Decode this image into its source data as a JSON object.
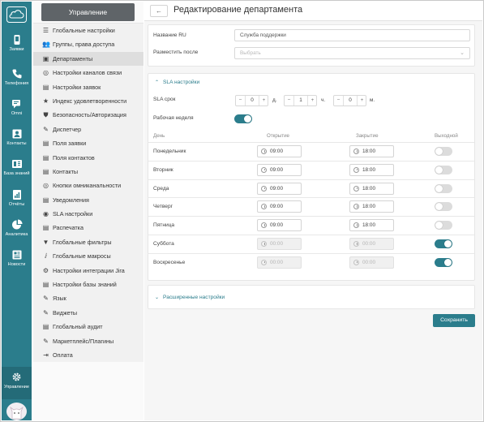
{
  "rail": {
    "items": [
      {
        "label": "Заявки",
        "icon": "phone-device-icon"
      },
      {
        "label": "Телефония",
        "icon": "phone-icon"
      },
      {
        "label": "Omni",
        "icon": "chat-icon"
      },
      {
        "label": "Контакты",
        "icon": "contacts-icon"
      },
      {
        "label": "База знаний",
        "icon": "knowledge-base-icon"
      },
      {
        "label": "Отчёты",
        "icon": "reports-icon"
      },
      {
        "label": "Аналитика",
        "icon": "pie-chart-icon"
      },
      {
        "label": "Новости",
        "icon": "news-icon"
      }
    ],
    "bottom_label": "Управление"
  },
  "menu": {
    "title": "Управление",
    "items": [
      {
        "label": "Глобальные настройки",
        "icon": "sliders-icon"
      },
      {
        "label": "Группы, права доступа",
        "icon": "users-icon"
      },
      {
        "label": "Департаменты",
        "icon": "departments-icon"
      },
      {
        "label": "Настройки каналов связи",
        "icon": "channels-icon"
      },
      {
        "label": "Настройки заявок",
        "icon": "ticket-settings-icon"
      },
      {
        "label": "Индекс удовлетворенности",
        "icon": "star-icon"
      },
      {
        "label": "Безопасность/Авторизация",
        "icon": "shield-icon"
      },
      {
        "label": "Диспетчер",
        "icon": "dispatcher-icon"
      },
      {
        "label": "Поля заявки",
        "icon": "fields-icon"
      },
      {
        "label": "Поля контактов",
        "icon": "contact-fields-icon"
      },
      {
        "label": "Контакты",
        "icon": "contacts-icon"
      },
      {
        "label": "Кнопки омниканальности",
        "icon": "omni-buttons-icon"
      },
      {
        "label": "Уведомления",
        "icon": "bell-icon"
      },
      {
        "label": "SLA настройки",
        "icon": "sla-icon"
      },
      {
        "label": "Распечатка",
        "icon": "print-icon"
      },
      {
        "label": "Глобальные фильтры",
        "icon": "filter-icon"
      },
      {
        "label": "Глобальные макросы",
        "icon": "macro-icon"
      },
      {
        "label": "Настройки интеграции Jira",
        "icon": "jira-icon"
      },
      {
        "label": "Настройки базы знаний",
        "icon": "kb-settings-icon"
      },
      {
        "label": "Язык",
        "icon": "language-icon"
      },
      {
        "label": "Виджеты",
        "icon": "widgets-icon"
      },
      {
        "label": "Глобальный аудит",
        "icon": "audit-icon"
      },
      {
        "label": "Маркетплейс/Плагины",
        "icon": "plugin-icon"
      },
      {
        "label": "Оплата",
        "icon": "payment-icon"
      }
    ],
    "active_index": 2
  },
  "page": {
    "title": "Редактирование департамента",
    "back": "←"
  },
  "form": {
    "name_label": "Название RU",
    "name_value": "Служба поддержки",
    "place_after_label": "Разместить после",
    "place_after_placeholder": "Выбрать"
  },
  "sla": {
    "section_title": "SLA настройки",
    "term_label": "SLA срок",
    "days": "0",
    "days_unit": "д.",
    "hours": "1",
    "hours_unit": "ч.",
    "minutes": "0",
    "minutes_unit": "м.",
    "workweek_label": "Рабочая неделя",
    "workweek_on": true,
    "columns": {
      "day": "День",
      "open": "Открытие",
      "close": "Закрытие",
      "off": "Выходной"
    },
    "schedule": [
      {
        "day": "Понедельник",
        "open": "09:00",
        "close": "18:00",
        "off": false
      },
      {
        "day": "Вторник",
        "open": "09:00",
        "close": "18:00",
        "off": false
      },
      {
        "day": "Среда",
        "open": "09:00",
        "close": "18:00",
        "off": false
      },
      {
        "day": "Четверг",
        "open": "09:00",
        "close": "18:00",
        "off": false
      },
      {
        "day": "Пятница",
        "open": "09:00",
        "close": "18:00",
        "off": false
      },
      {
        "day": "Суббота",
        "open": "00:00",
        "close": "00:00",
        "off": true
      },
      {
        "day": "Воскресенье",
        "open": "00:00",
        "close": "00:00",
        "off": true
      }
    ]
  },
  "advanced": {
    "title": "Расширенные настройки"
  },
  "save_label": "Сохранить",
  "colors": {
    "accent": "#2b7d8c",
    "menu_header": "#5f6468"
  }
}
